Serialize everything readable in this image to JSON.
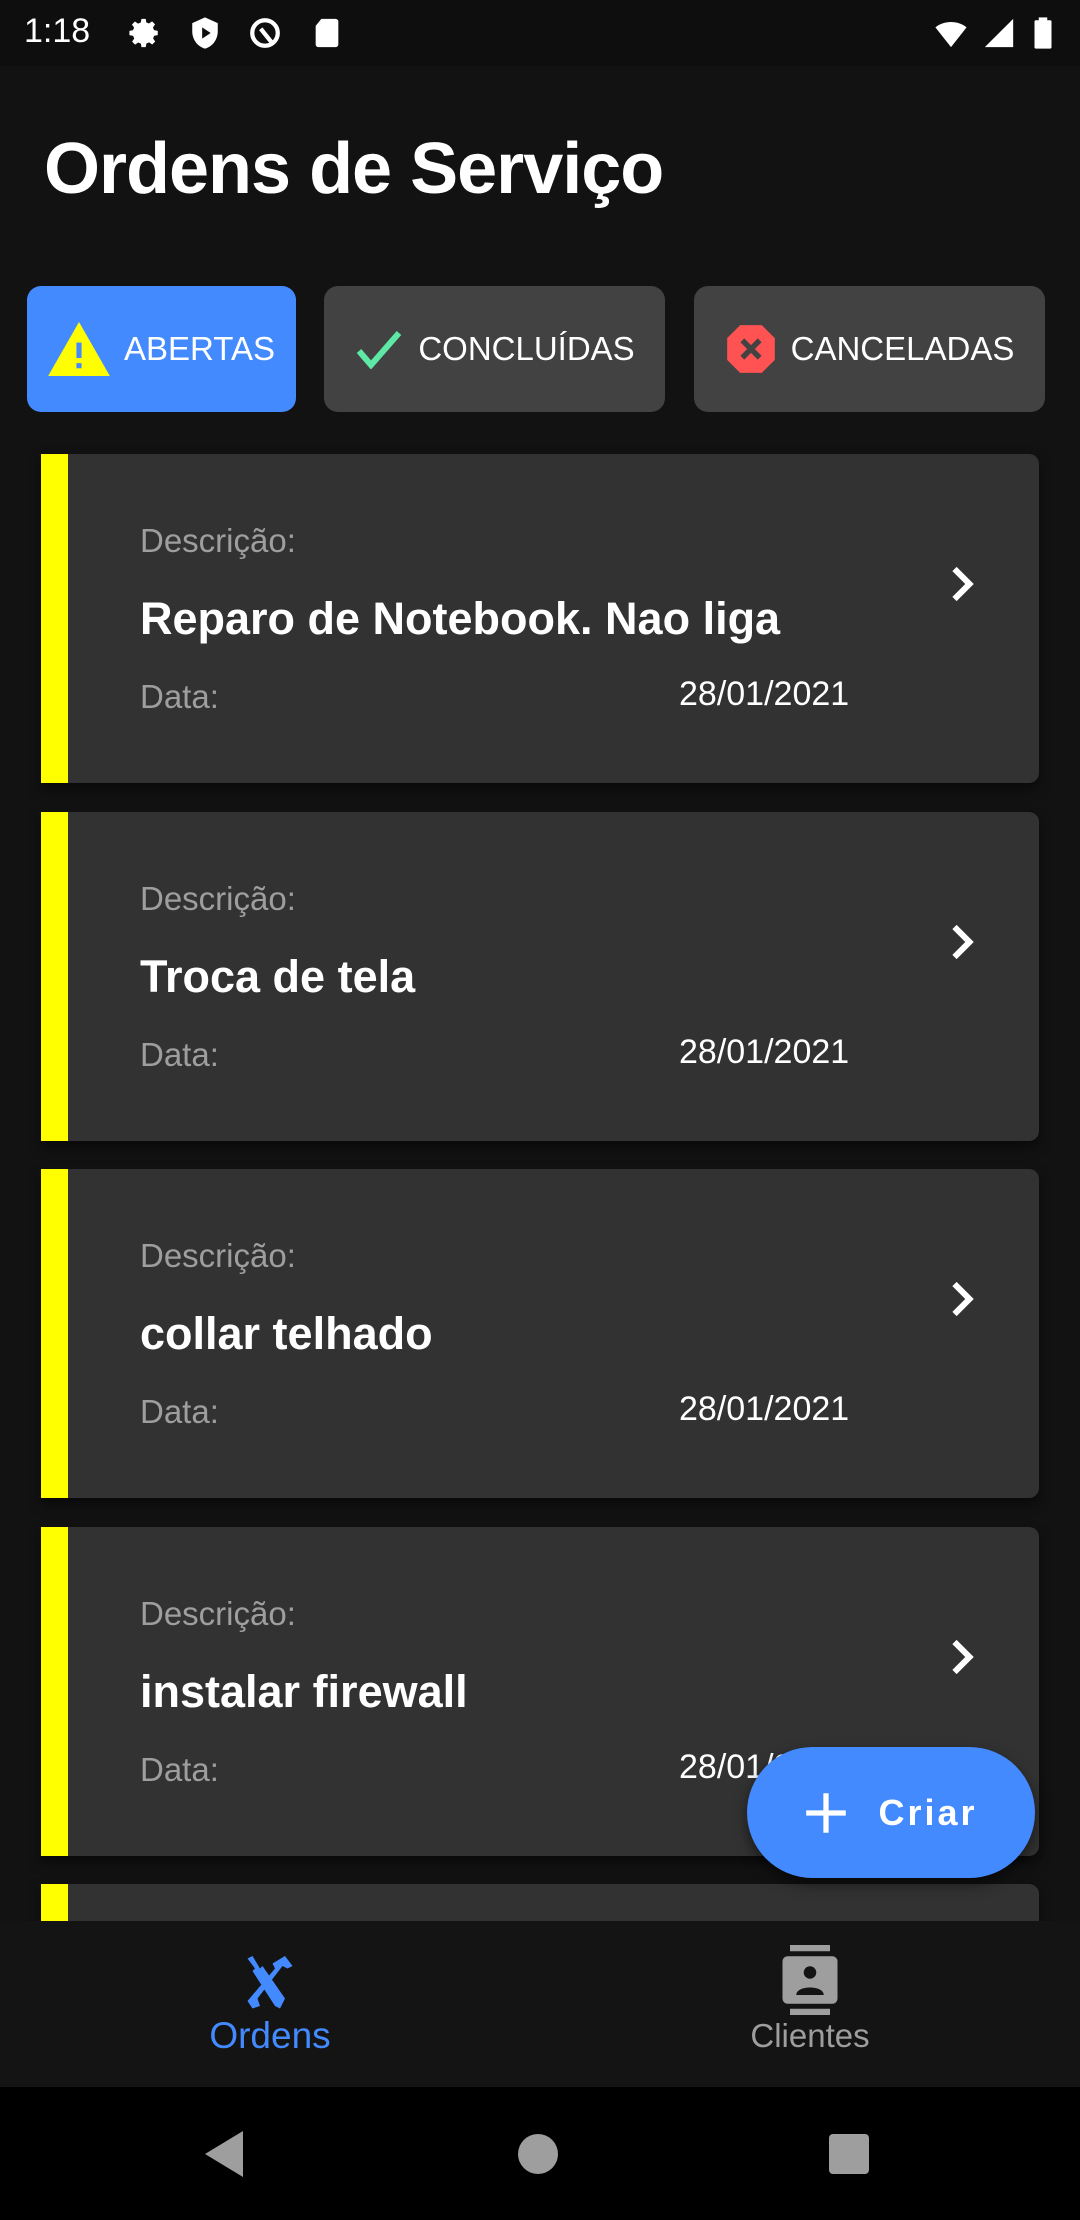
{
  "status_bar": {
    "time": "1:18",
    "icons": [
      "gear-icon",
      "shield-play-icon",
      "at-sign-icon",
      "sd-card-icon"
    ],
    "right_icons": [
      "wifi-icon",
      "signal-icon",
      "battery-icon"
    ]
  },
  "header": {
    "title": "Ordens de Serviço"
  },
  "tabs": [
    {
      "label": "ABERTAS",
      "icon": "warning-icon",
      "active": true
    },
    {
      "label": "CONCLUÍDAS",
      "icon": "check-icon",
      "active": false
    },
    {
      "label": "CANCELADAS",
      "icon": "cancel-octagon-icon",
      "active": false
    }
  ],
  "orders": [
    {
      "desc_label": "Descrição:",
      "description": "Reparo de Notebook. Nao liga",
      "date_label": "Data:",
      "date": "28/01/2021"
    },
    {
      "desc_label": "Descrição:",
      "description": "Troca de tela",
      "date_label": "Data:",
      "date": "28/01/2021"
    },
    {
      "desc_label": "Descrição:",
      "description": "collar telhado",
      "date_label": "Data:",
      "date": "28/01/2021"
    },
    {
      "desc_label": "Descrição:",
      "description": "instalar firewall",
      "date_label": "Data:",
      "date": "28/01/2021"
    }
  ],
  "fab": {
    "label": "Criar"
  },
  "bottom_nav": [
    {
      "label": "Ordens",
      "active": true
    },
    {
      "label": "Clientes",
      "active": false
    }
  ],
  "colors": {
    "accent": "#448aff",
    "status_open": "#ffff00",
    "card": "#323232",
    "done": "#5ee8a6",
    "cancel": "#ff5252"
  }
}
